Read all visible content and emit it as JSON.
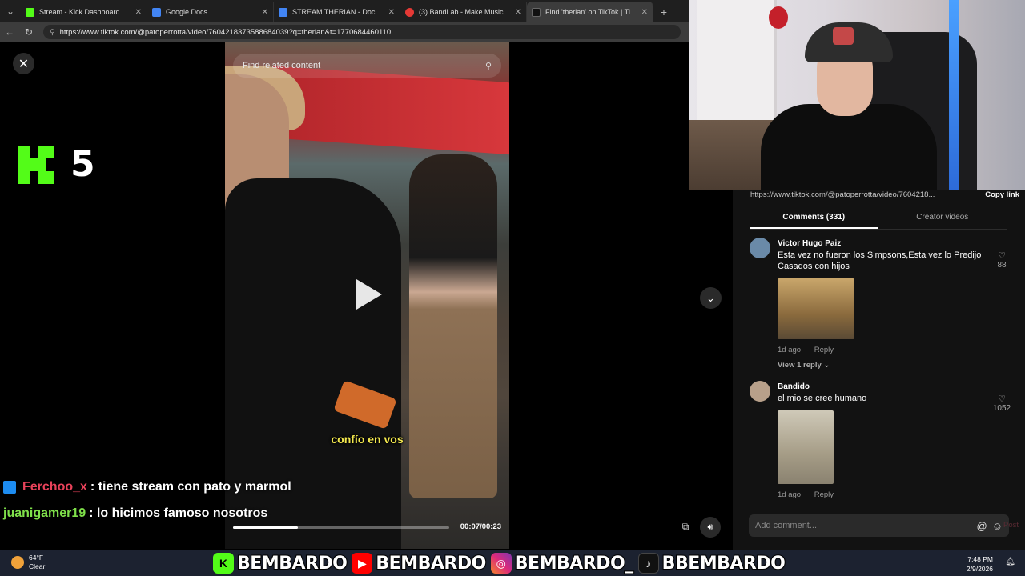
{
  "browser": {
    "tabs": [
      {
        "label": "Stream - Kick Dashboard",
        "color": "#53fc18",
        "active": false
      },
      {
        "label": "Google Docs",
        "color": "#4285f4",
        "active": false
      },
      {
        "label": "STREAM THERIAN - Documentos de",
        "color": "#4285f4",
        "active": false
      },
      {
        "label": "(3) BandLab - Make Music Online",
        "color": "#e53935",
        "active": false
      },
      {
        "label": "Find 'therian' on TikTok | TikTok Se",
        "color": "#111111",
        "active": true
      }
    ],
    "url": "https://www.tiktok.com/@patoperrotta/video/7604218373588684039?q=therian&t=1770684460110"
  },
  "overlay": {
    "kick_count": "5"
  },
  "video": {
    "search_placeholder": "Find related content",
    "caption": "confío en vos",
    "time": "00:07/00:23",
    "progress_fraction": 0.3
  },
  "chat": [
    {
      "user": "Ferchoo_x",
      "user_color": "#e8425a",
      "msg": ": tiene stream con pato y marmol",
      "badge": true
    },
    {
      "user": "juanigamer19",
      "user_color": "#7fe04a",
      "msg": ": lo hicimos famoso nosotros",
      "badge": false
    }
  ],
  "panel": {
    "link_text": "https://www.tiktok.com/@patoperrotta/video/7604218...",
    "copy_label": "Copy link",
    "tabs": [
      {
        "label": "Comments (331)",
        "active": true
      },
      {
        "label": "Creator videos",
        "active": false
      }
    ],
    "comments": [
      {
        "name": "Victor Hugo Paiz",
        "text": "Esta vez no fueron los Simpsons,Esta vez lo Predijo Casados con hijos",
        "time": "1d ago",
        "reply": "Reply",
        "replies": "View 1 reply",
        "likes": "88",
        "avatar_color": "#6a8aa8",
        "image_color": "#b08a5a"
      },
      {
        "name": "Bandido",
        "text": "el mio se cree humano",
        "time": "1d ago",
        "reply": "Reply",
        "replies": "",
        "likes": "1052",
        "avatar_color": "#b8a08a",
        "image_color": "#a8a18c"
      }
    ],
    "input_placeholder": "Add comment...",
    "post_label": "Post"
  },
  "taskbar": {
    "weather_temp": "64°F",
    "weather_desc": "Clear",
    "socials": [
      {
        "icon": "kick-icon",
        "glyph": "K",
        "color": "#53fc18",
        "handle": "BEMBARDO"
      },
      {
        "icon": "youtube-icon",
        "glyph": "▶",
        "color": "#ff0000",
        "handle": "BEMBARDO"
      },
      {
        "icon": "instagram-icon",
        "glyph": "◎",
        "color": "#d62976",
        "handle": "BEMBARDO_"
      },
      {
        "icon": "tiktok-icon",
        "glyph": "♪",
        "color": "#111111",
        "handle": "BBEMBARDO"
      }
    ],
    "time": "7:48 PM",
    "date": "2/9/2026"
  }
}
